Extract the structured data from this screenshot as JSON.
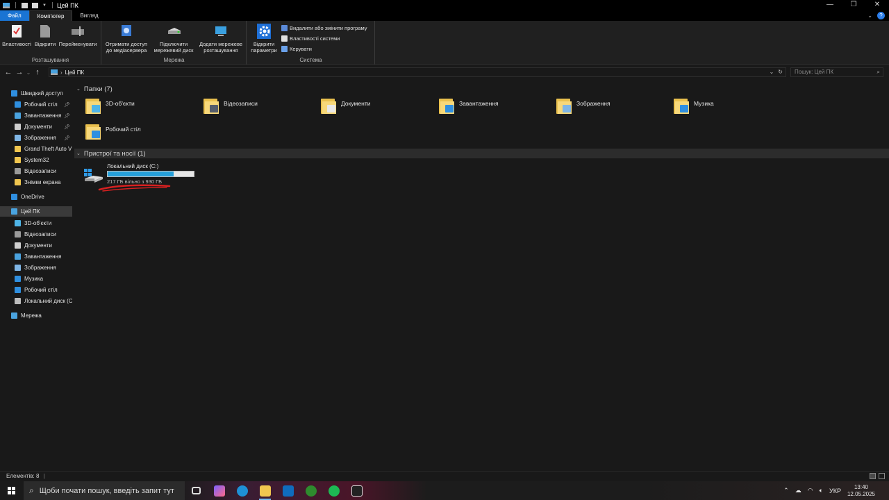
{
  "window": {
    "title": "Цей ПК"
  },
  "controls": {
    "minimize": "—",
    "maximize": "❐",
    "close": "✕"
  },
  "tabs": [
    "Файл",
    "Комп'ютер",
    "Вигляд"
  ],
  "help": "?",
  "ribbon": {
    "groups": {
      "location": {
        "label": "Розташування",
        "buttons": [
          "Властивості",
          "Відкрити",
          "Перейменувати"
        ]
      },
      "network": {
        "label": "Мережа",
        "buttons": [
          [
            "Отримати доступ",
            "до медіасервера"
          ],
          [
            "Підключити",
            "мережевий диск"
          ],
          [
            "Додати мережеве",
            "розташування"
          ]
        ]
      },
      "system": {
        "label": "Система",
        "open_settings": [
          "Відкрити",
          "параметри"
        ],
        "small": [
          "Видалити або змінити програму",
          "Властивості системи",
          "Керувати"
        ]
      }
    }
  },
  "address": {
    "path": "Цей ПК",
    "search_placeholder": "Пошук: Цей ПК"
  },
  "sidebar": {
    "items": [
      {
        "label": "Швидкий доступ",
        "icon": "star-icon",
        "color": "#2f8fe0",
        "pinned": false
      },
      {
        "label": "Робочий стіл",
        "icon": "desktop-icon",
        "color": "#2f8fe0",
        "pinned": true
      },
      {
        "label": "Завантаження",
        "icon": "download-icon",
        "color": "#4aa3df",
        "pinned": true
      },
      {
        "label": "Документи",
        "icon": "document-icon",
        "color": "#cfcfcf",
        "pinned": true
      },
      {
        "label": "Зображення",
        "icon": "image-icon",
        "color": "#7fb6e6",
        "pinned": true
      },
      {
        "label": "Grand Theft Auto V",
        "icon": "folder-icon",
        "color": "#f0c64f",
        "pinned": false
      },
      {
        "label": "System32",
        "icon": "folder-icon",
        "color": "#f0c64f",
        "pinned": false
      },
      {
        "label": "Відеозаписи",
        "icon": "video-icon",
        "color": "#9a9a9a",
        "pinned": false
      },
      {
        "label": "Знімки екрана",
        "icon": "folder-icon",
        "color": "#f0c64f",
        "pinned": false
      },
      {
        "label": "OneDrive",
        "icon": "cloud-icon",
        "color": "#2f8fe0",
        "pinned": false
      },
      {
        "label": "Цей ПК",
        "icon": "computer-icon",
        "color": "#4aa3df",
        "pinned": false
      },
      {
        "label": "3D-об'єкти",
        "icon": "cube-icon",
        "color": "#4fb5e8",
        "pinned": false
      },
      {
        "label": "Відеозаписи",
        "icon": "video-icon",
        "color": "#9a9a9a",
        "pinned": false
      },
      {
        "label": "Документи",
        "icon": "document-icon",
        "color": "#cfcfcf",
        "pinned": false
      },
      {
        "label": "Завантаження",
        "icon": "download-icon",
        "color": "#4aa3df",
        "pinned": false
      },
      {
        "label": "Зображення",
        "icon": "image-icon",
        "color": "#7fb6e6",
        "pinned": false
      },
      {
        "label": "Музика",
        "icon": "music-icon",
        "color": "#2f8fe0",
        "pinned": false
      },
      {
        "label": "Робочий стіл",
        "icon": "desktop-icon",
        "color": "#2f8fe0",
        "pinned": false
      },
      {
        "label": "Локальний диск (C:)",
        "icon": "drive-icon",
        "color": "#bdbdbd",
        "pinned": false
      },
      {
        "label": "Мережа",
        "icon": "network-icon",
        "color": "#4aa3df",
        "pinned": false
      }
    ]
  },
  "content": {
    "folders_header": "Папки (7)",
    "folders": [
      {
        "label": "3D-об'єкти",
        "badge": "#4fb5e8"
      },
      {
        "label": "Відеозаписи",
        "badge": "#555d6b"
      },
      {
        "label": "Документи",
        "badge": "#e8e8e8"
      },
      {
        "label": "Завантаження",
        "badge": "#2f8fe0"
      },
      {
        "label": "Зображення",
        "badge": "#7fb6e6"
      },
      {
        "label": "Музика",
        "badge": "#2f8fe0"
      },
      {
        "label": "Робочий стіл",
        "badge": "#2f8fe0"
      }
    ],
    "devices_header": "Пристрої та носії (1)",
    "drive": {
      "name": "Локальний диск (C:)",
      "free_text": "217 ГБ вільно з 930 ГБ",
      "used_fraction": 0.767
    }
  },
  "status": {
    "items": "Елементів: 8"
  },
  "taskbar": {
    "search_placeholder": "Щоби почати пошук, введіть запит тут",
    "lang": "УКР",
    "time": "13:40",
    "date": "12.05.2025"
  }
}
